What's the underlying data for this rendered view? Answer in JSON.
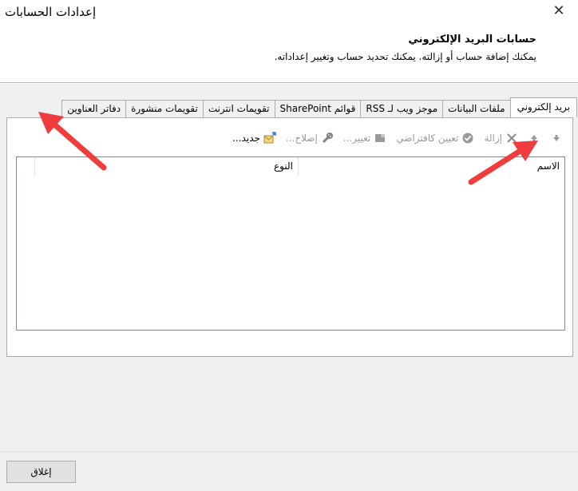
{
  "window": {
    "title": "إعدادات الحسابات",
    "close_glyph": "✕"
  },
  "header": {
    "title": "حسابات البريد الإلكتروني",
    "description": "يمكنك إضافة حساب أو إزالته. يمكنك تحديد حساب وتغيير إعداداته."
  },
  "tabs": [
    {
      "label": "بريد إلكتروني",
      "active": true
    },
    {
      "label": "ملفات البيانات",
      "active": false
    },
    {
      "label": "موجز ويب لـ RSS",
      "active": false
    },
    {
      "label": "قوائم SharePoint",
      "active": false
    },
    {
      "label": "تقويمات انترنت",
      "active": false
    },
    {
      "label": "تقويمات منشورة",
      "active": false
    },
    {
      "label": "دفاتر العناوين",
      "active": false
    }
  ],
  "toolbar": {
    "new": {
      "label": "جديد...",
      "enabled": true,
      "icon": "new-account-icon"
    },
    "repair": {
      "label": "إصلاح...",
      "enabled": false,
      "icon": "repair-icon"
    },
    "change": {
      "label": "تغيير...",
      "enabled": false,
      "icon": "change-icon"
    },
    "set_default": {
      "label": "تعيين كافتراضي",
      "enabled": false,
      "icon": "check-circle-icon"
    },
    "remove": {
      "label": "إزالة",
      "enabled": false,
      "icon": "remove-x-icon"
    },
    "move_up": {
      "icon": "arrow-up-icon",
      "enabled": false
    },
    "move_down": {
      "icon": "arrow-down-icon",
      "enabled": false
    }
  },
  "list": {
    "columns": [
      "الاسم",
      "النوع"
    ],
    "rows": []
  },
  "footer": {
    "close_label": "إغلاق"
  },
  "annotations": {
    "arrow_color": "#f03c3c"
  },
  "colors": {
    "disabled_text": "#9a9a9a",
    "panel_background": "#f0f0f0"
  }
}
